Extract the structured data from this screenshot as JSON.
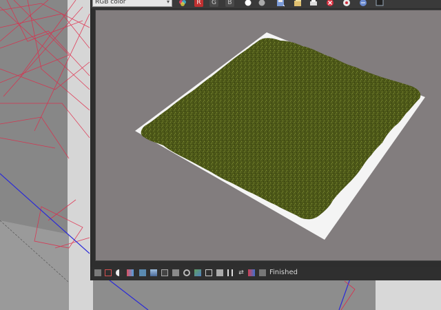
{
  "window": {
    "channel_select": "RGB color",
    "channel_buttons": [
      "R",
      "G",
      "B"
    ],
    "status": "Finished"
  },
  "toolbar_icons": [
    "display-correction-icon",
    "red-channel-icon",
    "green-channel-icon",
    "blue-channel-icon",
    "alpha-white-icon",
    "monochrome-icon",
    "save-image-icon",
    "clone-frame-buffer-icon",
    "print-icon",
    "clear-image-icon",
    "render-icon",
    "open-settings-icon"
  ],
  "status_icons": [
    "frame-buffer-history-icon",
    "region-render-icon",
    "color-clamp-icon",
    "view-clamped-icon",
    "lut-icon",
    "levels-icon",
    "curves-icon",
    "pixel-info-icon",
    "exposure-icon",
    "background-image-icon",
    "lens-effects-icon",
    "stamp-icon",
    "srgb-icon",
    "dpi-icon",
    "follow-mouse-icon",
    "compare-ab-icon",
    "render-elements-icon",
    "stop-icon"
  ],
  "colors": {
    "viewport_bg": "#8d8d8d",
    "frame_buffer_bg": "#2e2e2e",
    "render_bg": "#827d7e",
    "grass": "#4f5a1c",
    "plane": "#f4f4f4",
    "wire_red": "#e02848",
    "wire_blue": "#2a2ad8"
  }
}
